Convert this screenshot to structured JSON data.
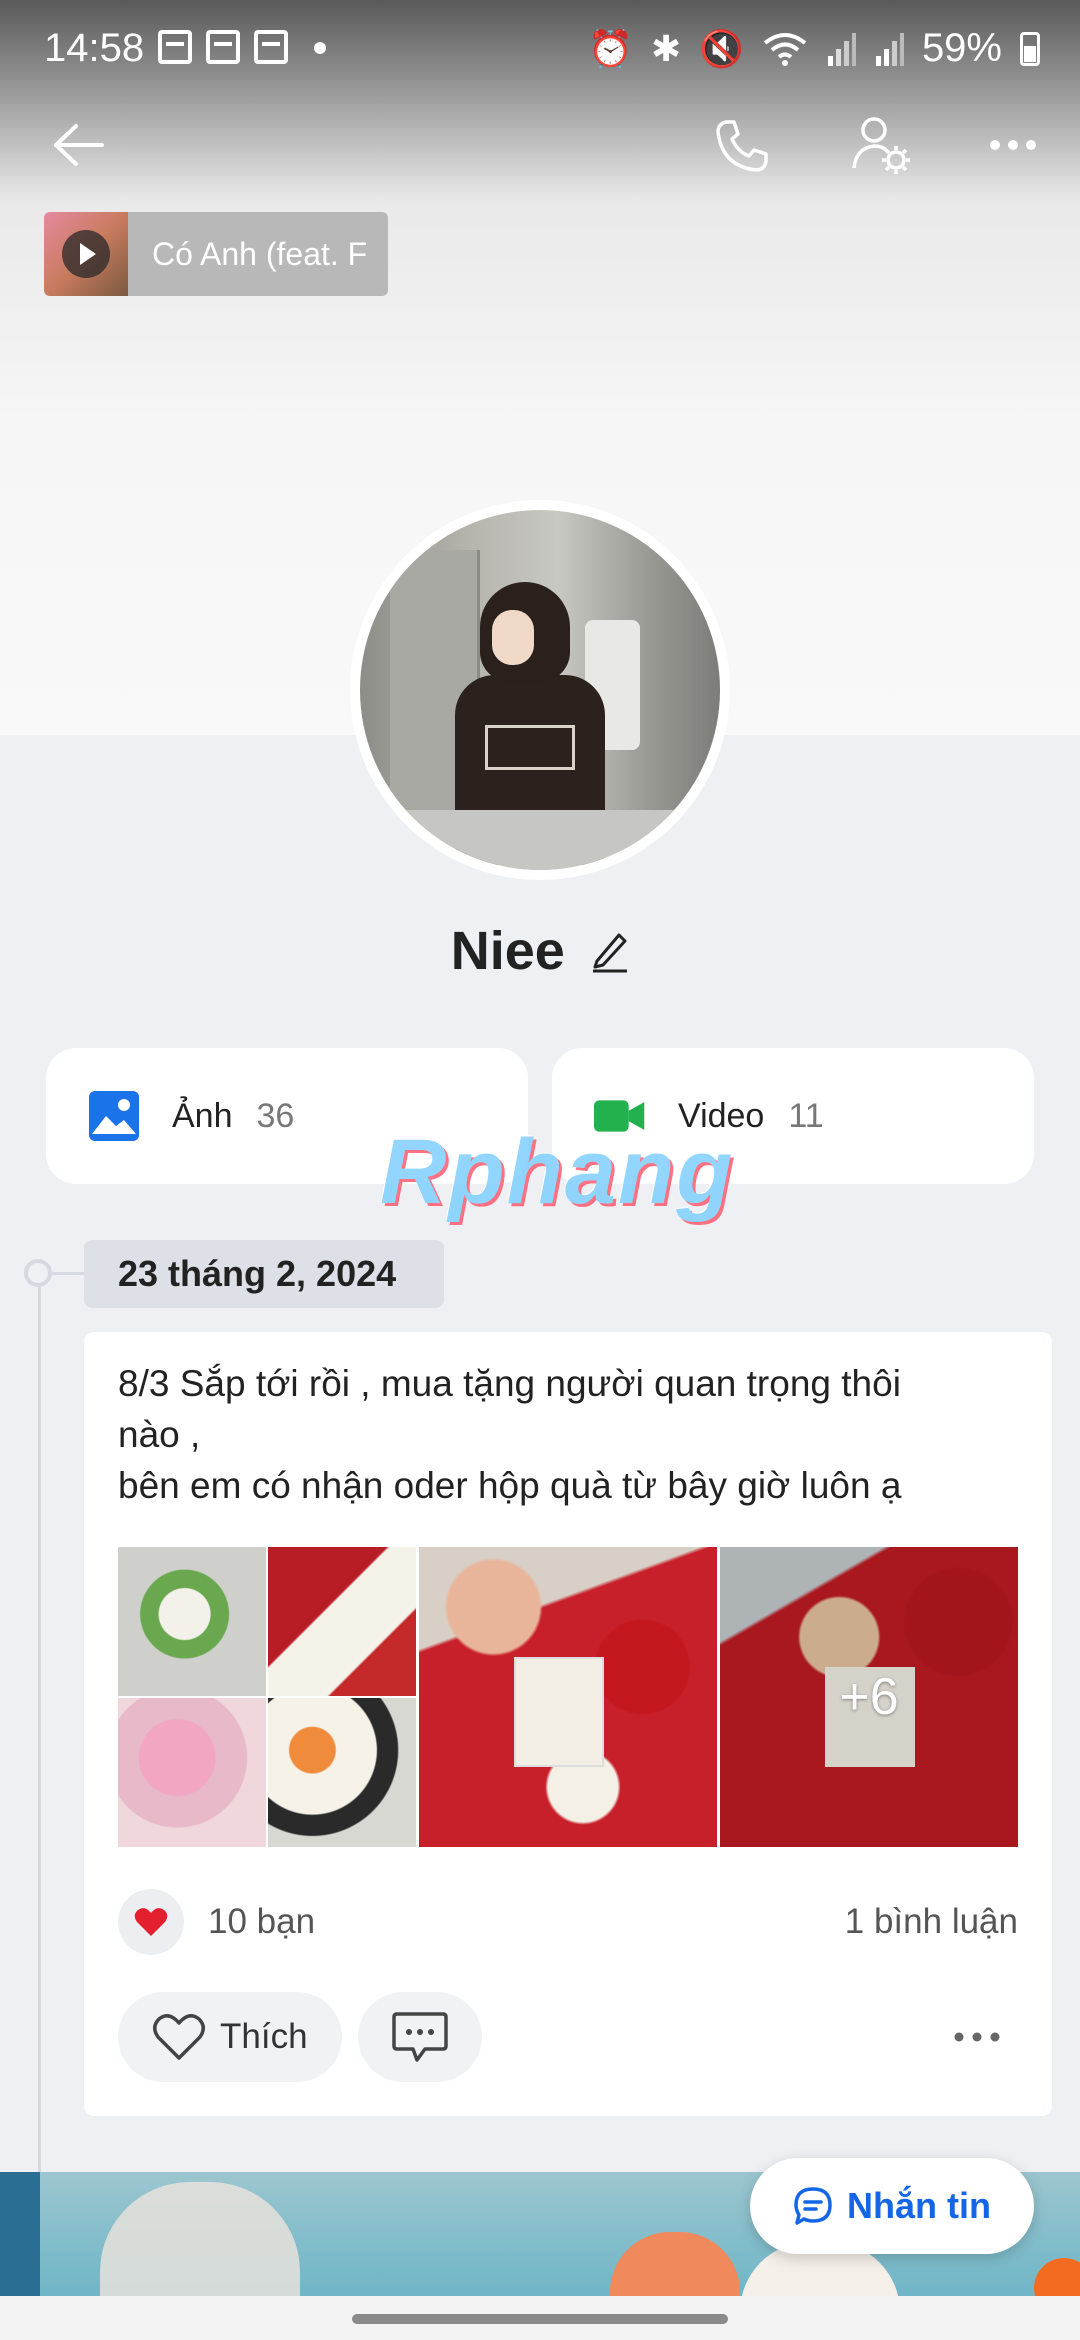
{
  "status_bar": {
    "time": "14:58",
    "battery": "59%"
  },
  "music": {
    "title": "Có Anh (feat. F"
  },
  "profile": {
    "name": "Niee"
  },
  "media": {
    "photos": {
      "label": "Ảnh",
      "count": "36"
    },
    "videos": {
      "label": "Video",
      "count": "11"
    }
  },
  "watermark": "Rphang",
  "timeline": {
    "date": "23 tháng 2, 2024"
  },
  "post": {
    "lines": [
      "8/3 Sắp tới rồi , mua tặng người quan trọng thôi",
      "nào ,",
      "bên em có nhận oder hộp quà từ bây giờ luôn ạ"
    ],
    "more_photos": "+6",
    "reactions": "10 bạn",
    "comments": "1 bình luận",
    "like_label": "Thích"
  },
  "message_button": {
    "label": "Nhắn tin"
  },
  "colors": {
    "accent": "#1466e6",
    "photo_icon": "#1a73e8",
    "video_icon": "#22b14c",
    "heart": "#e5202e"
  }
}
